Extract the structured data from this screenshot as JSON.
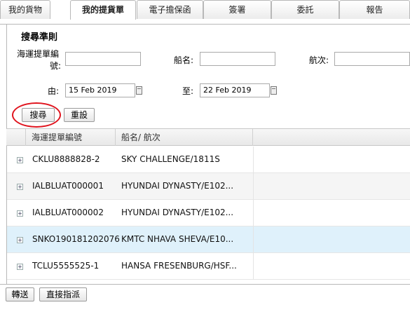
{
  "tabs": [
    {
      "label": "我的貨物",
      "active": false
    },
    {
      "label": "我的提貨單",
      "active": true
    },
    {
      "label": "電子擔保函",
      "active": false
    },
    {
      "label": "簽署",
      "active": false
    },
    {
      "label": "委託",
      "active": false
    },
    {
      "label": "報告",
      "active": false
    }
  ],
  "search": {
    "title": "搜尋準則",
    "bl_label_line1": "海運提單編",
    "bl_label_line2": "號:",
    "bl_value": "",
    "vessel_label": "船名:",
    "vessel_value": "",
    "voyage_label": "航次:",
    "voyage_value": "",
    "from_label": "由:",
    "from_value": "15 Feb 2019",
    "to_label": "至:",
    "to_value": "22 Feb 2019",
    "search_button": "搜尋",
    "reset_button": "重設"
  },
  "grid": {
    "columns": [
      "海運提單編號",
      "船名/ 航次"
    ],
    "rows": [
      {
        "bl": "CKLU8888828-2",
        "vessel": "SKY CHALLENGE/1811S",
        "selected": false
      },
      {
        "bl": "IALBLUAT000001",
        "vessel": "HYUNDAI DYNASTY/E102...",
        "selected": false
      },
      {
        "bl": "IALBLUAT000002",
        "vessel": "HYUNDAI DYNASTY/E102...",
        "selected": false
      },
      {
        "bl": "SNKO190181202076",
        "vessel": "KMTC NHAVA SHEVA/E10...",
        "selected": true
      },
      {
        "bl": "TCLU5555525-1",
        "vessel": "HANSA FRESENBURG/HSF...",
        "selected": false
      }
    ]
  },
  "footer": {
    "forward_button": "轉送",
    "direct_assign_button": "直接指派"
  },
  "colors": {
    "highlight_ring": "#e0141e",
    "selected_row": "#dff1fb"
  }
}
